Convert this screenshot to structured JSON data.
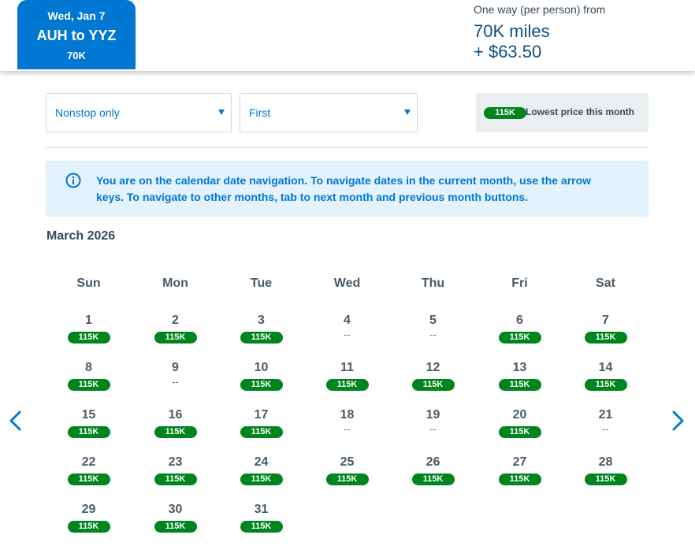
{
  "selected_flight": {
    "date": "Wed, Jan 7",
    "route": "AUH to YYZ",
    "price": "70K"
  },
  "fare": {
    "label": "One way (per person) from",
    "miles": "70K miles",
    "taxes": "+ $63.50"
  },
  "filters": {
    "stops": "Nonstop only",
    "cabin": "First"
  },
  "legend": {
    "badge": "115K",
    "text": "Lowest price this month"
  },
  "info_message": "You are on the calendar date navigation. To navigate dates in the current month, use the arrow keys. To navigate to other months, tab to next month and previous month buttons.",
  "calendar": {
    "month": "March 2026",
    "weekdays": [
      "Sun",
      "Mon",
      "Tue",
      "Wed",
      "Thu",
      "Fri",
      "Sat"
    ],
    "first_weekday": 0,
    "days": [
      {
        "day": "1",
        "price": "115K"
      },
      {
        "day": "2",
        "price": "115K"
      },
      {
        "day": "3",
        "price": "115K"
      },
      {
        "day": "4",
        "price": "--"
      },
      {
        "day": "5",
        "price": "--"
      },
      {
        "day": "6",
        "price": "115K"
      },
      {
        "day": "7",
        "price": "115K"
      },
      {
        "day": "8",
        "price": "115K"
      },
      {
        "day": "9",
        "price": "--"
      },
      {
        "day": "10",
        "price": "115K"
      },
      {
        "day": "11",
        "price": "115K"
      },
      {
        "day": "12",
        "price": "115K"
      },
      {
        "day": "13",
        "price": "115K"
      },
      {
        "day": "14",
        "price": "115K"
      },
      {
        "day": "15",
        "price": "115K"
      },
      {
        "day": "16",
        "price": "115K"
      },
      {
        "day": "17",
        "price": "115K"
      },
      {
        "day": "18",
        "price": "--"
      },
      {
        "day": "19",
        "price": "--"
      },
      {
        "day": "20",
        "price": "115K"
      },
      {
        "day": "21",
        "price": "--"
      },
      {
        "day": "22",
        "price": "115K"
      },
      {
        "day": "23",
        "price": "115K"
      },
      {
        "day": "24",
        "price": "115K"
      },
      {
        "day": "25",
        "price": "115K"
      },
      {
        "day": "26",
        "price": "115K"
      },
      {
        "day": "27",
        "price": "115K"
      },
      {
        "day": "28",
        "price": "115K"
      },
      {
        "day": "29",
        "price": "115K"
      },
      {
        "day": "30",
        "price": "115K"
      },
      {
        "day": "31",
        "price": "115K"
      }
    ]
  },
  "colors": {
    "brand_blue": "#0078d2",
    "price_green": "#00851e",
    "info_bg": "#e3f2fb",
    "legend_bg": "#e9eef1"
  },
  "icons": {
    "info": "info-circle-icon",
    "prev": "chevron-left-icon",
    "next": "chevron-right-icon",
    "dropdown": "caret-down-icon"
  }
}
